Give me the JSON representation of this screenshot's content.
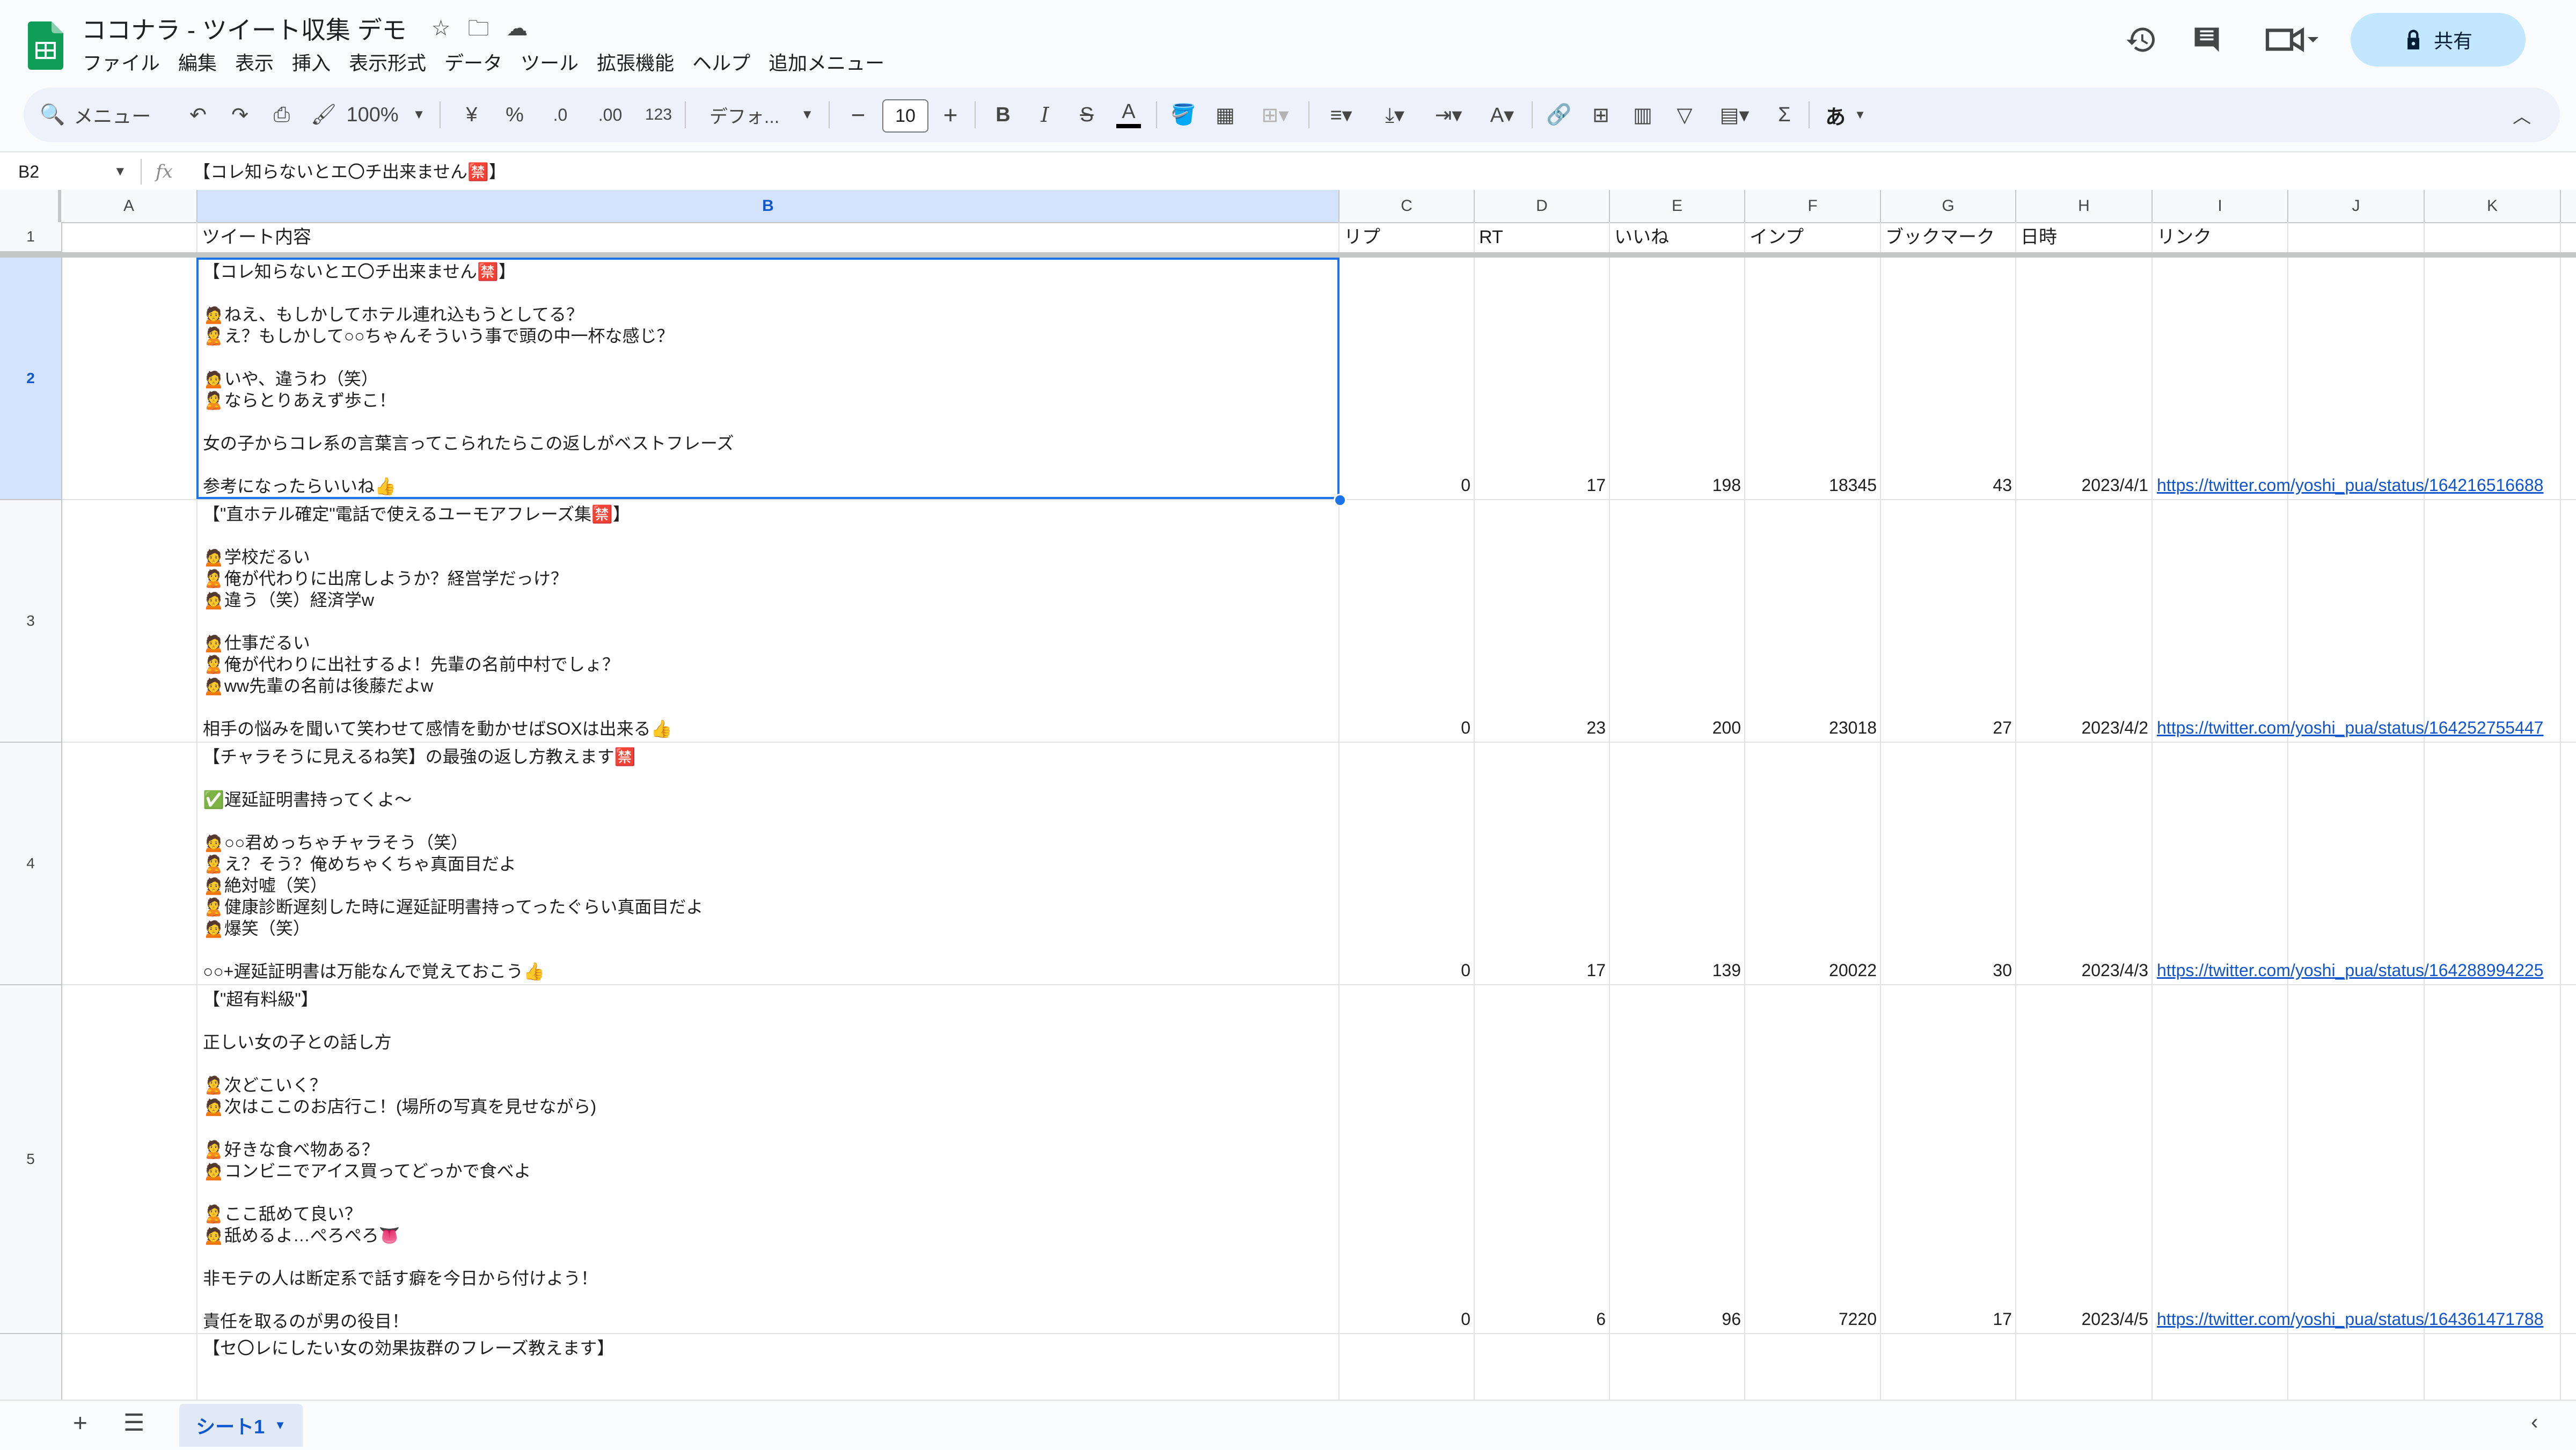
{
  "app": {
    "doc_title": "ココナラ - ツイート収集 デモ",
    "menu": [
      "ファイル",
      "編集",
      "表示",
      "挿入",
      "表示形式",
      "データ",
      "ツール",
      "拡張機能",
      "ヘルプ",
      "追加メニュー"
    ],
    "share_label": "共有"
  },
  "toolbar": {
    "search_label": "メニュー",
    "zoom": "100%",
    "currency": "¥",
    "percent": "%",
    "decrease_decimal": ".0",
    "increase_decimal": ".00",
    "number_format": "123",
    "font_name": "デフォ...",
    "font_size": "10",
    "input_tool": "あ"
  },
  "formula_bar": {
    "cell_ref": "B2",
    "content": "【コレ知らないとエ〇チ出来ません🈲】"
  },
  "columns": [
    "A",
    "B",
    "C",
    "D",
    "E",
    "F",
    "G",
    "H",
    "I",
    "J",
    "K"
  ],
  "header_row": {
    "row_number": "1",
    "B": "ツイート内容",
    "C": "リプ",
    "D": "RT",
    "E": "いいね",
    "F": "インプ",
    "G": "ブックマーク",
    "H": "日時",
    "I": "リンク"
  },
  "rows": [
    {
      "row_number": "2",
      "text": "【コレ知らないとエ〇チ出来ません🈲】\n\n🙍ねえ、もしかしてホテル連れ込もうとしてる？\n🙎え？もしかして○○ちゃんそういう事で頭の中一杯な感じ？\n\n🙍いや、違うわ（笑）\n🙎ならとりあえず歩こ！\n\n女の子からコレ系の言葉言ってこられたらこの返しがベストフレーズ\n\n参考になったらいいね👍",
      "reply": "0",
      "rt": "17",
      "likes": "198",
      "imp": "18345",
      "bookmarks": "43",
      "date": "2023/4/1",
      "link": "https://twitter.com/yoshi_pua/status/164216516688"
    },
    {
      "row_number": "3",
      "text": "【\"直ホテル確定\"電話で使えるユーモアフレーズ集🈲】\n\n🙍学校だるい\n🙎俺が代わりに出席しようか？経営学だっけ？\n🙍違う（笑）経済学w\n\n🙍仕事だるい\n🙎俺が代わりに出社するよ！先輩の名前中村でしょ？\n🙍ww先輩の名前は後藤だよw\n\n相手の悩みを聞いて笑わせて感情を動かせばSOXは出来る👍",
      "reply": "0",
      "rt": "23",
      "likes": "200",
      "imp": "23018",
      "bookmarks": "27",
      "date": "2023/4/2",
      "link": "https://twitter.com/yoshi_pua/status/164252755447"
    },
    {
      "row_number": "4",
      "text": "【チャラそうに見えるね笑】の最強の返し方教えます🈲\n\n✅遅延証明書持ってくよ～\n\n🙍○○君めっちゃチャラそう（笑）\n🙎え？そう？俺めちゃくちゃ真面目だよ\n🙍絶対嘘（笑）\n🙎健康診断遅刻した時に遅延証明書持ってったぐらい真面目だよ\n🙍爆笑（笑）\n\n○○+遅延証明書は万能なんで覚えておこう👍",
      "reply": "0",
      "rt": "17",
      "likes": "139",
      "imp": "20022",
      "bookmarks": "30",
      "date": "2023/4/3",
      "link": "https://twitter.com/yoshi_pua/status/164288994225"
    },
    {
      "row_number": "5",
      "text": "【\"超有料級\"】\n\n正しい女の子との話し方\n\n🙎次どこいく？\n🙍次はここのお店行こ！(場所の写真を見せながら)\n\n🙎好きな食べ物ある？\n🙍コンビニでアイス買ってどっかで食べよ\n\n🙎ここ舐めて良い？\n🙍舐めるよ…ぺろぺろ👅\n\n非モテの人は断定系で話す癖を今日から付けよう！\n\n責任を取るのが男の役目！",
      "reply": "0",
      "rt": "6",
      "likes": "96",
      "imp": "7220",
      "bookmarks": "17",
      "date": "2023/4/5",
      "link": "https://twitter.com/yoshi_pua/status/164361471788"
    },
    {
      "row_number": "",
      "text": "【セ〇レにしたい女の効果抜群のフレーズ教えます】"
    }
  ],
  "sheets": {
    "active": "シート1"
  },
  "colors": {
    "accent": "#0b57d0",
    "selection": "#1a73e8",
    "share_bg": "#c2e7ff",
    "link": "#1155cc",
    "logo_green": "#0f9d58"
  }
}
